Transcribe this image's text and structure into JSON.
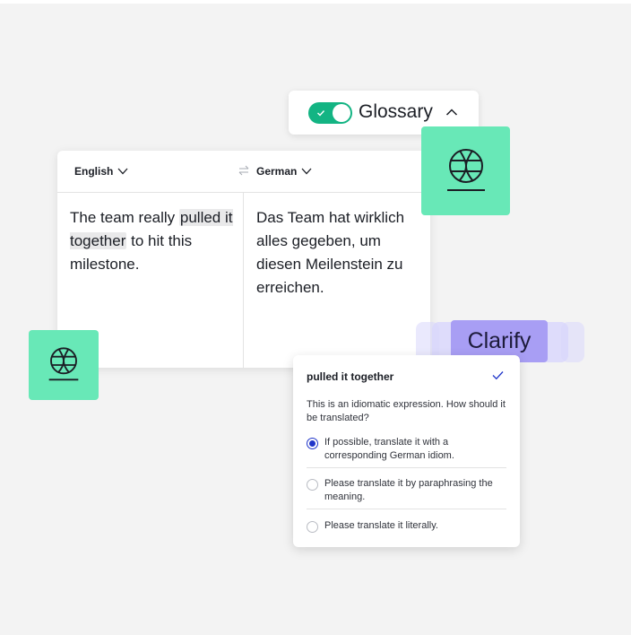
{
  "glossary": {
    "label": "Glossary",
    "enabled": true
  },
  "translator": {
    "source_language": "English",
    "target_language": "German",
    "source_text_before": "The team really ",
    "source_highlight": "pulled it together",
    "source_text_after": " to hit this milestone.",
    "target_text": "Das Team hat wirklich alles gegeben, um diesen Meilenstein zu erreichen."
  },
  "clarify": {
    "badge": "Clarify",
    "phrase": "pulled it together",
    "question": "This is an idiomatic expression. How should it be translated?",
    "options": [
      {
        "label": "If possible, translate it with a corresponding German idiom.",
        "selected": true
      },
      {
        "label": "Please translate it by paraphrasing the meaning.",
        "selected": false
      },
      {
        "label": "Please translate it literally.",
        "selected": false
      }
    ]
  },
  "colors": {
    "accent_green": "#68e8b7",
    "toggle_green": "#13b483",
    "clarify_purple": "#a89ef4",
    "radio_blue": "#1f35c9"
  },
  "icons": [
    "globe-icon",
    "check-icon",
    "chevron-down-icon",
    "chevron-up-icon",
    "swap-arrows-icon"
  ]
}
